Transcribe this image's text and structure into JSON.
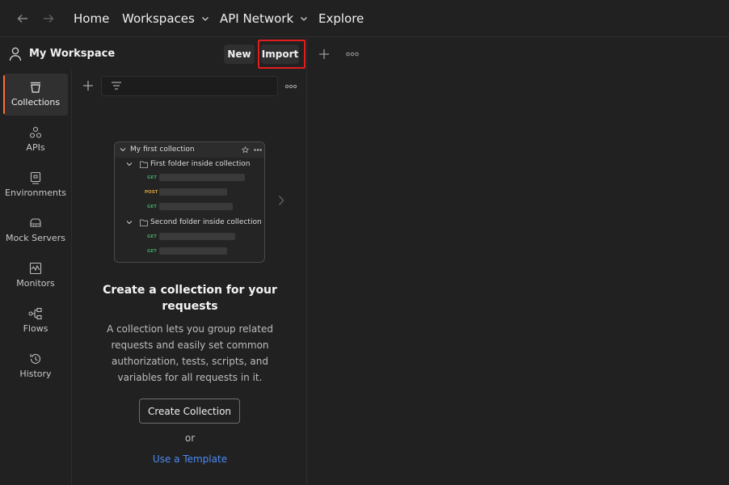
{
  "topbar": {
    "nav": {
      "home": "Home",
      "workspaces": "Workspaces",
      "api_network": "API Network",
      "explore": "Explore"
    }
  },
  "workspace": {
    "title": "My Workspace",
    "new_label": "New",
    "import_label": "Import"
  },
  "sidebar": {
    "items": [
      {
        "label": "Collections",
        "icon": "collections-icon",
        "active": true
      },
      {
        "label": "APIs",
        "icon": "apis-icon"
      },
      {
        "label": "Environments",
        "icon": "environments-icon"
      },
      {
        "label": "Mock Servers",
        "icon": "mock-servers-icon"
      },
      {
        "label": "Monitors",
        "icon": "monitors-icon"
      },
      {
        "label": "Flows",
        "icon": "flows-icon"
      },
      {
        "label": "History",
        "icon": "history-icon"
      }
    ]
  },
  "illustration": {
    "collection_name": "My first collection",
    "folder1": "First folder inside collection",
    "folder2": "Second folder inside collection",
    "methods": [
      "GET",
      "POST",
      "GET",
      "GET",
      "GET"
    ]
  },
  "empty_state": {
    "heading": "Create a collection for your requests",
    "description": "A collection lets you group related requests and easily set common authorization, tests, scripts, and variables for all requests in it.",
    "create_button": "Create Collection",
    "or": "or",
    "template_link": "Use a Template"
  },
  "colors": {
    "accent": "#ff6c37",
    "highlight_outline": "#e11d1d",
    "link": "#4c8bf5",
    "get_method": "#3ca35f",
    "post_method": "#d7a13a"
  }
}
